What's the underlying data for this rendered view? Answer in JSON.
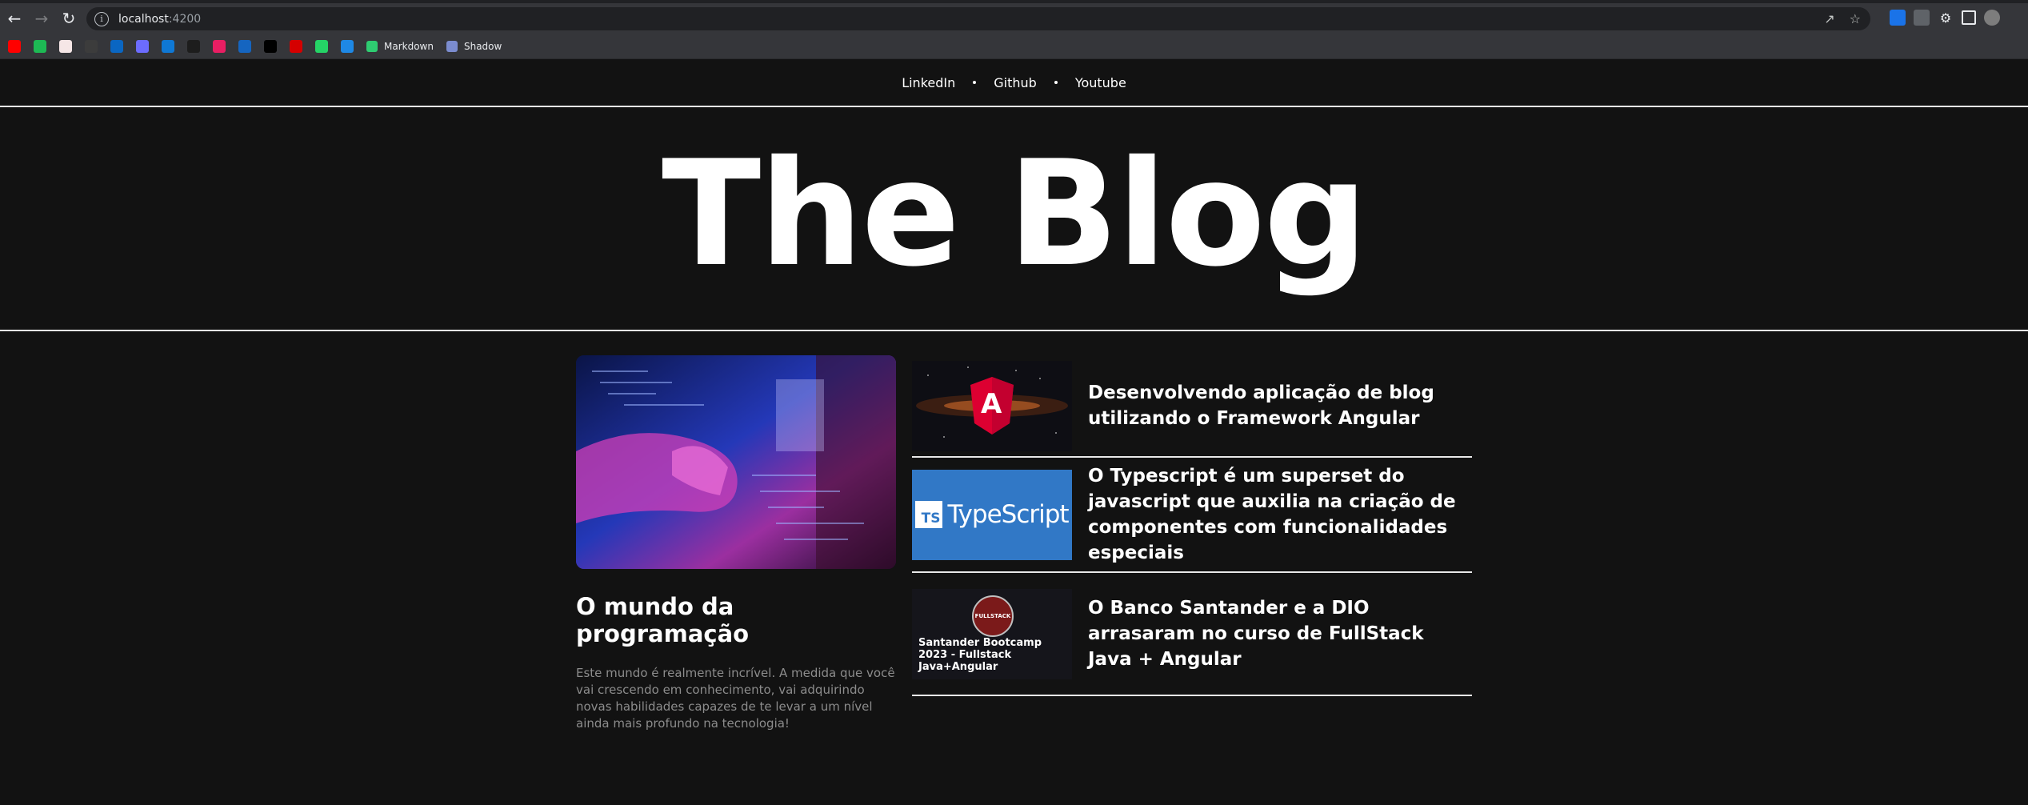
{
  "browser": {
    "url_host": "localhost",
    "url_port": ":4200",
    "bookmarks": [
      {
        "name": "youtube",
        "color": "#ff0000"
      },
      {
        "name": "spotify",
        "color": "#1db954"
      },
      {
        "name": "app",
        "color": "#f5e6e6"
      },
      {
        "name": "github",
        "color": "#3c3c3c"
      },
      {
        "name": "linkedin",
        "color": "#0a66c2"
      },
      {
        "name": "circle",
        "color": "#6c6cff"
      },
      {
        "name": "outlook",
        "color": "#0f78d4"
      },
      {
        "name": "dark",
        "color": "#1d1d1d"
      },
      {
        "name": "pink",
        "color": "#e91e63"
      },
      {
        "name": "shield",
        "color": "#1565c0"
      },
      {
        "name": "ft",
        "color": "#000000"
      },
      {
        "name": "red",
        "color": "#d50000"
      },
      {
        "name": "whatsapp",
        "color": "#25d366"
      },
      {
        "name": "blue",
        "color": "#1e88e5"
      }
    ],
    "bookmark_links": [
      {
        "label": "Markdown",
        "color": "#2ecc71"
      },
      {
        "label": "Shadow",
        "color": "#7b8ccf"
      }
    ]
  },
  "nav": {
    "links": [
      "LinkedIn",
      "Github",
      "Youtube"
    ]
  },
  "hero": {
    "title": "The Blog"
  },
  "featured": {
    "title": "O mundo da programação",
    "description": "Este mundo é realmente incrível. A medida que você vai crescendo em conhecimento, vai adquirindo novas habilidades capazes de te levar a um nível ainda mais profundo na tecnologia!"
  },
  "posts": [
    {
      "title": "Desenvolvendo aplicação de blog utilizando o Framework Angular",
      "thumb_label": "A"
    },
    {
      "title": "O Typescript é um superset do javascript que auxilia na criação de componentes com funcionalidades especiais",
      "thumb_label": "TypeScript",
      "thumb_badge": "TS"
    },
    {
      "title": "O Banco Santander e a DIO arrasaram no curso de FullStack Java + Angular",
      "thumb_label": "Santander Bootcamp 2023 - Fullstack Java+Angular",
      "thumb_badge": "FULLSTACK"
    }
  ]
}
